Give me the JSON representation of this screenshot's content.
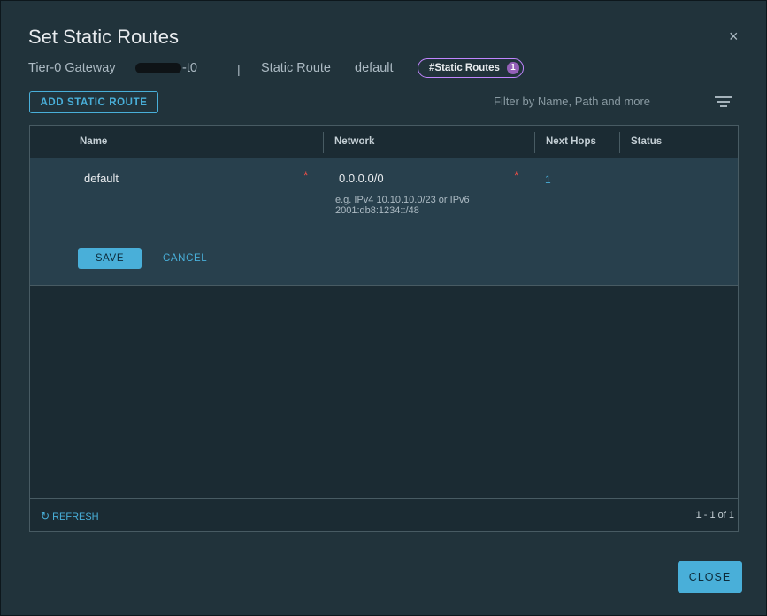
{
  "dialog": {
    "title": "Set Static Routes",
    "close_symbol": "×"
  },
  "subheader": {
    "gateway_label": "Tier-0 Gateway",
    "gateway_name_suffix": "-t0",
    "separator": "|",
    "section_label": "Static Route",
    "route_name": "default",
    "pill_label": "#Static Routes",
    "pill_count": "1"
  },
  "toolbar": {
    "add_label": "ADD STATIC ROUTE",
    "filter_placeholder": "Filter by Name, Path and more"
  },
  "grid": {
    "columns": [
      "Name",
      "Network",
      "Next Hops",
      "Status"
    ],
    "edit_row": {
      "name_value": "default",
      "network_value": "0.0.0.0/0",
      "network_hint": "e.g. IPv4 10.10.10.0/23 or IPv6 2001:db8:1234::/48",
      "next_hops": "1",
      "required_mark": "*",
      "save_label": "SAVE",
      "cancel_label": "CANCEL"
    },
    "footer": {
      "refresh_label": "REFRESH",
      "pagination": "1 - 1 of 1"
    }
  },
  "footer": {
    "close_label": "CLOSE"
  },
  "colors": {
    "accent": "#49afd9",
    "background": "#21333b",
    "edit_row": "#28404d",
    "required": "#f54f47",
    "pill_border": "#c085ff"
  },
  "icons": {
    "refresh": "refresh-icon",
    "filter": "filter-icon",
    "close": "close-icon"
  }
}
